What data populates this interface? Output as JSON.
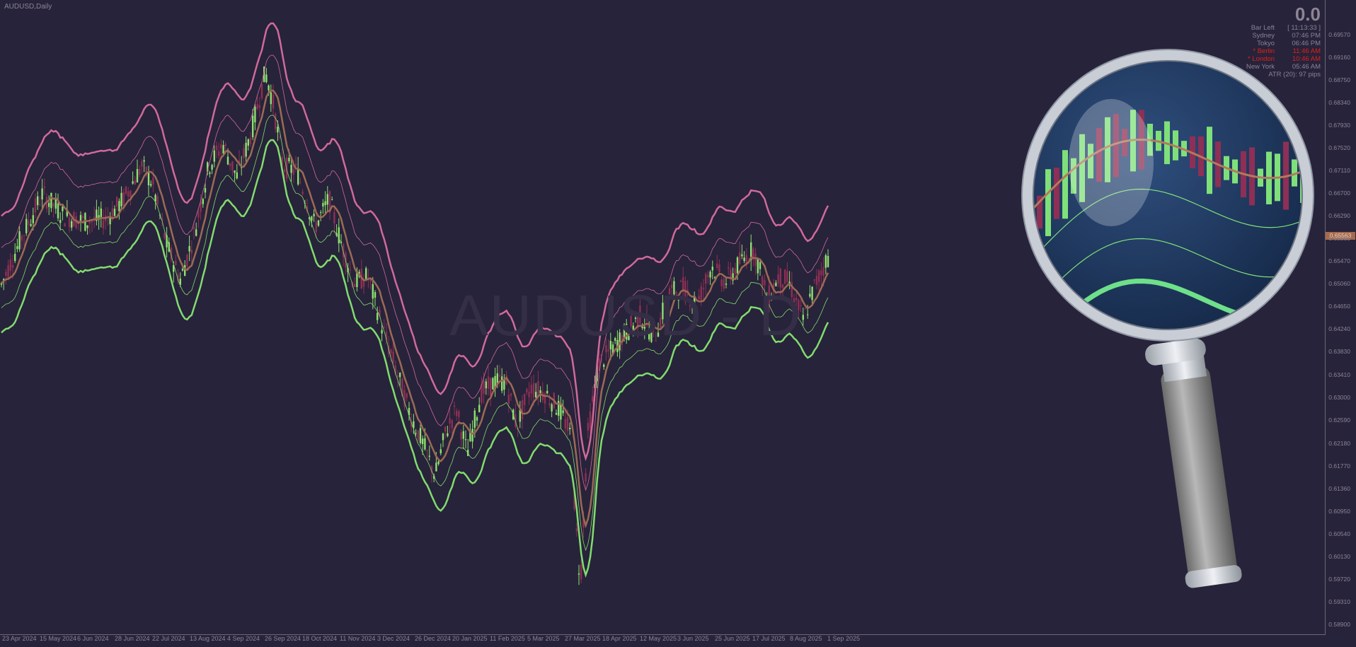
{
  "window": {
    "symbol_title": "AUDUSD,Daily",
    "watermark": "AUDUSD - D"
  },
  "info_panel": {
    "big_value": "0.0",
    "rows": [
      {
        "key": "Bar Left",
        "value": "[ 11:13:33 ]",
        "highlight": false
      },
      {
        "key": "Sydney",
        "value": "07:46 PM",
        "highlight": false
      },
      {
        "key": "Tokyo",
        "value": "06:46 PM",
        "highlight": false
      },
      {
        "key": "* Berlin",
        "value": "11:46 AM",
        "highlight": true
      },
      {
        "key": "* London",
        "value": "10:46 AM",
        "highlight": true
      },
      {
        "key": "New York",
        "value": "05:46 AM",
        "highlight": false
      },
      {
        "key": "ATR (20): 97 pips",
        "value": "",
        "highlight": false
      }
    ]
  },
  "current_price_label": "0.65563",
  "colors": {
    "background": "#27233a",
    "bull": "#8ee070",
    "bear": "#8e2f55",
    "ma": "#9b6a55",
    "upper_band": "#d06a9a",
    "lower_band": "#82dc6e",
    "magnifier_ring": "#c9cdd6",
    "lens": "#1d3a63"
  },
  "icons": {
    "magnifier": "magnifying-glass-icon"
  },
  "chart_data": {
    "type": "candlestick",
    "title": "AUDUSD,Daily",
    "ylim": [
      0.589,
      0.7
    ],
    "y_ticks": [
      "0.69570",
      "0.69160",
      "0.68750",
      "0.68340",
      "0.67930",
      "0.67520",
      "0.67110",
      "0.66700",
      "0.66290",
      "0.65880",
      "0.65470",
      "0.65060",
      "0.64650",
      "0.64240",
      "0.63830",
      "0.63410",
      "0.63000",
      "0.62590",
      "0.62180",
      "0.61770",
      "0.61360",
      "0.60950",
      "0.60540",
      "0.60130",
      "0.59720",
      "0.59310",
      "0.58900"
    ],
    "x_ticks": [
      "23 Apr 2024",
      "15 May 2024",
      "6 Jun 2024",
      "28 Jun 2024",
      "22 Jul 2024",
      "13 Aug 2024",
      "4 Sep 2024",
      "26 Sep 2024",
      "18 Oct 2024",
      "11 Nov 2024",
      "3 Dec 2024",
      "26 Dec 2024",
      "20 Jan 2025",
      "11 Feb 2025",
      "5 Mar 2025",
      "27 Mar 2025",
      "18 Apr 2025",
      "12 May 2025",
      "3 Jun 2025",
      "25 Jun 2025",
      "17 Jul 2025",
      "8 Aug 2025",
      "1 Sep 2025"
    ],
    "price_path": [
      [
        0,
        0.65
      ],
      [
        30,
        0.659
      ],
      [
        60,
        0.667
      ],
      [
        90,
        0.663
      ],
      [
        120,
        0.662
      ],
      [
        150,
        0.6625
      ],
      [
        175,
        0.666
      ],
      [
        200,
        0.672
      ],
      [
        215,
        0.669
      ],
      [
        235,
        0.658
      ],
      [
        255,
        0.6515
      ],
      [
        275,
        0.66
      ],
      [
        295,
        0.672
      ],
      [
        315,
        0.676
      ],
      [
        335,
        0.67
      ],
      [
        355,
        0.678
      ],
      [
        375,
        0.689
      ],
      [
        385,
        0.684
      ],
      [
        400,
        0.672
      ],
      [
        420,
        0.671
      ],
      [
        445,
        0.661
      ],
      [
        465,
        0.666
      ],
      [
        480,
        0.659
      ],
      [
        500,
        0.651
      ],
      [
        520,
        0.652
      ],
      [
        540,
        0.643
      ],
      [
        560,
        0.635
      ],
      [
        580,
        0.627
      ],
      [
        600,
        0.621
      ],
      [
        615,
        0.616
      ],
      [
        630,
        0.624
      ],
      [
        645,
        0.628
      ],
      [
        660,
        0.62
      ],
      [
        680,
        0.631
      ],
      [
        700,
        0.633
      ],
      [
        715,
        0.633
      ],
      [
        730,
        0.625
      ],
      [
        750,
        0.632
      ],
      [
        770,
        0.631
      ],
      [
        790,
        0.628
      ],
      [
        805,
        0.624
      ],
      [
        815,
        0.605
      ],
      [
        820,
        0.596
      ],
      [
        830,
        0.623
      ],
      [
        845,
        0.636
      ],
      [
        865,
        0.639
      ],
      [
        885,
        0.642
      ],
      [
        905,
        0.645
      ],
      [
        925,
        0.641
      ],
      [
        945,
        0.649
      ],
      [
        965,
        0.65
      ],
      [
        985,
        0.647
      ],
      [
        1005,
        0.654
      ],
      [
        1025,
        0.651
      ],
      [
        1045,
        0.6545
      ],
      [
        1065,
        0.657
      ],
      [
        1085,
        0.648
      ],
      [
        1100,
        0.652
      ],
      [
        1115,
        0.651
      ],
      [
        1135,
        0.644
      ],
      [
        1150,
        0.65
      ],
      [
        1170,
        0.6556
      ]
    ]
  }
}
